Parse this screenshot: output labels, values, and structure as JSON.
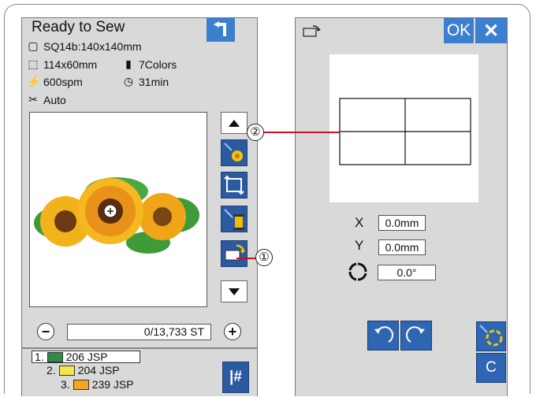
{
  "left_panel": {
    "title": "Ready to Sew",
    "info": {
      "hoop": "SQ14b:140x140mm",
      "size": "114x60mm",
      "colors": "7Colors",
      "speed": "600spm",
      "time": "31min",
      "thread_cut": "Auto"
    },
    "icons": {
      "back": "back-arrow-icon",
      "hoop": "hoop-icon",
      "size": "design-size-icon",
      "colors": "thread-spool-icon",
      "speed": "running-speed-icon",
      "time": "clock-icon",
      "thread_cut": "scissors-icon"
    },
    "stitch_counter": "0/13,733 ST",
    "minus": "−",
    "plus": "+",
    "threads": [
      {
        "index": "1.",
        "name": "206 JSP",
        "color": "#2e8b4a"
      },
      {
        "index": "2.",
        "name": "204 JSP",
        "color": "#f2e64c"
      },
      {
        "index": "3.",
        "name": "239 JSP",
        "color": "#f5a623"
      }
    ],
    "jump_label": "#"
  },
  "right_panel": {
    "ok_label": "OK",
    "close_label": "✕",
    "x_label": "X",
    "x_value": "0.0mm",
    "y_label": "Y",
    "y_value": "0.0mm",
    "angle_value": "0.0°",
    "reset_label": "C"
  },
  "callouts": {
    "one": "①",
    "two": "②"
  },
  "colors": {
    "panel_bg": "#d9d9d9",
    "button_blue": "#3d7fcf",
    "leader_red": "#d01020"
  }
}
